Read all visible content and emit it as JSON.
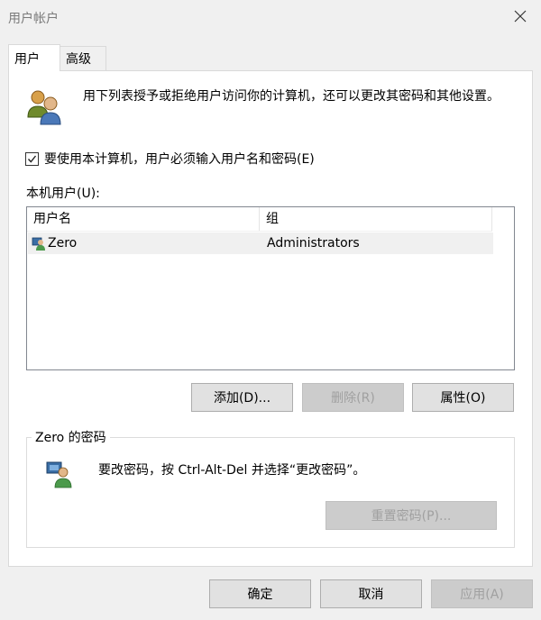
{
  "window": {
    "title": "用户帐户"
  },
  "tabs": [
    {
      "label": "用户",
      "selected": true
    },
    {
      "label": "高级",
      "selected": false
    }
  ],
  "description": "用下列表授予或拒绝用户访问你的计算机，还可以更改其密码和其他设置。",
  "checkbox": {
    "label": "要使用本计算机，用户必须输入用户名和密码(E)",
    "checked": true
  },
  "local_users": {
    "label": "本机用户(U):",
    "columns": [
      "用户名",
      "组"
    ],
    "rows": [
      {
        "user": "Zero",
        "group": "Administrators"
      }
    ]
  },
  "buttons": {
    "add": "添加(D)...",
    "remove": "删除(R)",
    "properties": "属性(O)"
  },
  "password_group": {
    "title": "Zero 的密码",
    "text": "要改密码，按 Ctrl-Alt-Del 并选择“更改密码”。",
    "reset_button": "重置密码(P)..."
  },
  "footer": {
    "ok": "确定",
    "cancel": "取消",
    "apply": "应用(A)"
  },
  "colors": {
    "window_bg": "#f0f0f0",
    "panel_bg": "#ffffff",
    "selected_row": "#f0f0f0",
    "disabled_text": "#a0a0a0"
  }
}
